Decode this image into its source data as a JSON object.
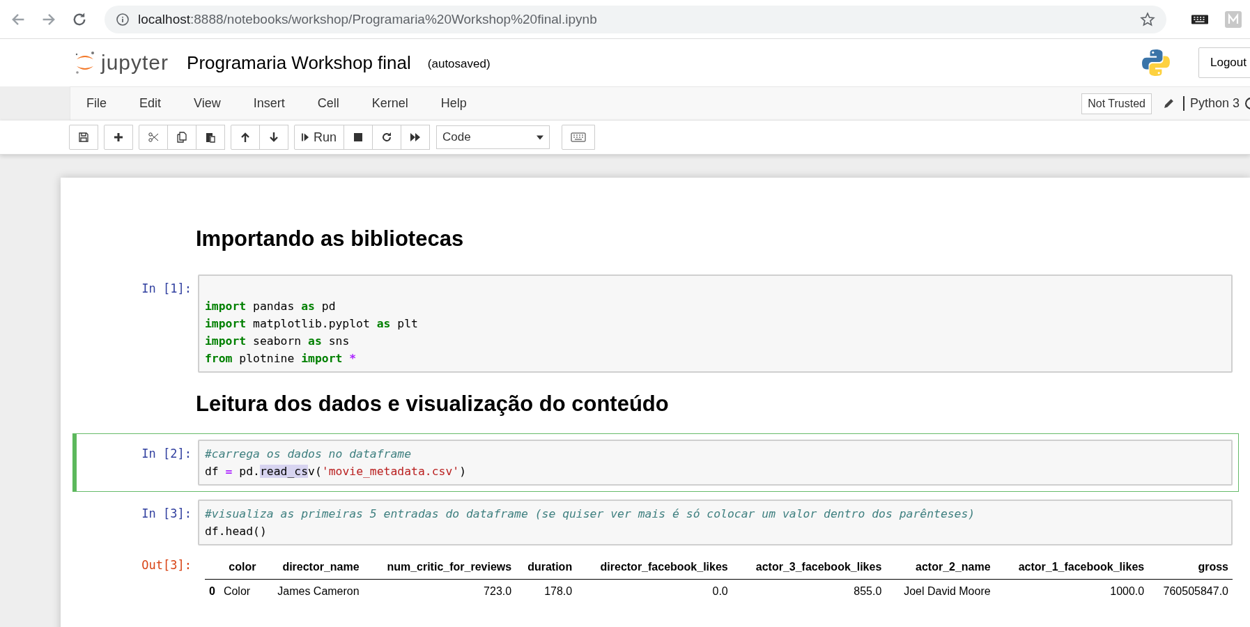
{
  "browser": {
    "url_host": "localhost",
    "url_path": ":8888/notebooks/workshop/Programaria%20Workshop%20final.ipynb"
  },
  "header": {
    "logo_text": "jupyter",
    "title": "Programaria Workshop final",
    "save_status": "(autosaved)",
    "logout": "Logout"
  },
  "menu": [
    "File",
    "Edit",
    "View",
    "Insert",
    "Cell",
    "Kernel",
    "Help"
  ],
  "trust": "Not Trusted",
  "kernel": "Python 3",
  "toolbar": {
    "run": "Run",
    "cell_type": "Code"
  },
  "cells": [
    {
      "kind": "markdown",
      "text": "Importando as bibliotecas"
    },
    {
      "kind": "code",
      "prompt": "In [1]:",
      "selected": false,
      "blank_first_line": true,
      "lines": [
        [
          {
            "kind": "kw",
            "s": "import"
          },
          {
            "kind": "plain",
            "s": " pandas "
          },
          {
            "kind": "kw",
            "s": "as"
          },
          {
            "kind": "plain",
            "s": " pd"
          }
        ],
        [
          {
            "kind": "kw",
            "s": "import"
          },
          {
            "kind": "plain",
            "s": " matplotlib.pyplot "
          },
          {
            "kind": "kw",
            "s": "as"
          },
          {
            "kind": "plain",
            "s": " plt"
          }
        ],
        [
          {
            "kind": "kw",
            "s": "import"
          },
          {
            "kind": "plain",
            "s": " seaborn "
          },
          {
            "kind": "kw",
            "s": "as"
          },
          {
            "kind": "plain",
            "s": " sns"
          }
        ],
        [
          {
            "kind": "kw",
            "s": "from"
          },
          {
            "kind": "plain",
            "s": " plotnine "
          },
          {
            "kind": "kw",
            "s": "import"
          },
          {
            "kind": "op",
            "s": " *"
          }
        ]
      ]
    },
    {
      "kind": "markdown",
      "text": "Leitura dos dados e visualização do conteúdo"
    },
    {
      "kind": "code",
      "prompt": "In [2]:",
      "selected": true,
      "lines": [
        [
          {
            "kind": "comment",
            "s": "#carrega os dados no dataframe"
          }
        ],
        [
          {
            "kind": "plain",
            "s": "df "
          },
          {
            "kind": "op",
            "s": "="
          },
          {
            "kind": "plain",
            "s": " pd."
          },
          {
            "kind": "match",
            "s": "read_cs"
          },
          {
            "kind": "plain",
            "s": "v("
          },
          {
            "kind": "str",
            "s": "'movie_metadata.csv'"
          },
          {
            "kind": "plain",
            "s": ")"
          }
        ]
      ]
    },
    {
      "kind": "code",
      "prompt": "In [3]:",
      "selected": false,
      "lines": [
        [
          {
            "kind": "comment",
            "s": "#visualiza as primeiras 5 entradas do dataframe (se quiser ver mais é só colocar um valor dentro dos parênteses)"
          }
        ],
        [
          {
            "kind": "plain",
            "s": "df.head()"
          }
        ]
      ],
      "output": {
        "prompt": "Out[3]:",
        "columns": [
          "color",
          "director_name",
          "num_critic_for_reviews",
          "duration",
          "director_facebook_likes",
          "actor_3_facebook_likes",
          "actor_2_name",
          "actor_1_facebook_likes",
          "gross"
        ],
        "rows": [
          {
            "index": "0",
            "cells": [
              "Color",
              "James Cameron",
              "723.0",
              "178.0",
              "0.0",
              "855.0",
              "Joel David Moore",
              "1000.0",
              "760505847.0"
            ]
          }
        ]
      }
    }
  ]
}
